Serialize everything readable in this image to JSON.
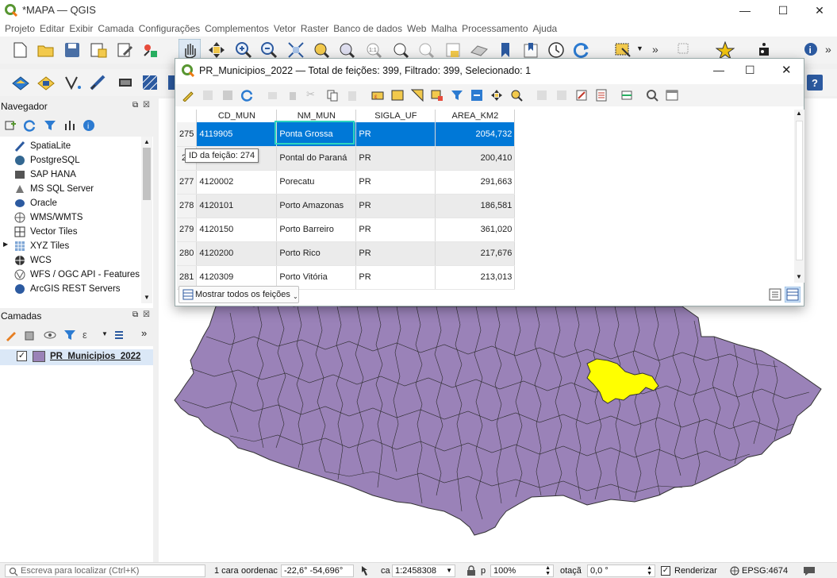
{
  "app": {
    "title": "*MAPA — QGIS"
  },
  "menu": [
    "Projeto",
    "Editar",
    "Exibir",
    "Camada",
    "Configurações",
    "Complementos",
    "Vetor",
    "Raster",
    "Banco de dados",
    "Web",
    "Malha",
    "Processamento",
    "Ajuda"
  ],
  "navigator": {
    "title": "Navegador",
    "items": [
      "SpatiaLite",
      "PostgreSQL",
      "SAP HANA",
      "MS SQL Server",
      "Oracle",
      "WMS/WMTS",
      "Vector Tiles",
      "XYZ Tiles",
      "WCS",
      "WFS / OGC API - Features",
      "ArcGIS REST Servers"
    ]
  },
  "layers": {
    "title": "Camadas",
    "layer_name": "PR_Municipios_2022"
  },
  "dialog": {
    "title": "PR_Municipios_2022 — Total de feições: 399, Filtrado: 399, Selecionado: 1",
    "columns": [
      "CD_MUN",
      "NM_MUN",
      "SIGLA_UF",
      "AREA_KM2"
    ],
    "rows": [
      {
        "n": "275",
        "cd": "4119905",
        "nm": "Ponta Grossa",
        "uf": "PR",
        "area": "2054,732"
      },
      {
        "n": "27",
        "cd": "",
        "nm": "Pontal do Paraná",
        "uf": "PR",
        "area": "200,410"
      },
      {
        "n": "277",
        "cd": "4120002",
        "nm": "Porecatu",
        "uf": "PR",
        "area": "291,663"
      },
      {
        "n": "278",
        "cd": "4120101",
        "nm": "Porto Amazonas",
        "uf": "PR",
        "area": "186,581"
      },
      {
        "n": "279",
        "cd": "4120150",
        "nm": "Porto Barreiro",
        "uf": "PR",
        "area": "361,020"
      },
      {
        "n": "280",
        "cd": "4120200",
        "nm": "Porto Rico",
        "uf": "PR",
        "area": "217,676"
      },
      {
        "n": "281",
        "cd": "4120309",
        "nm": "Porto Vitória",
        "uf": "PR",
        "area": "213,013"
      }
    ],
    "tooltip": "ID da feição: 274",
    "show_all": "Mostrar todos os feições"
  },
  "status": {
    "locator_placeholder": "Escreva para localizar (Ctrl+K)",
    "coord_label": "1 cara",
    "coord_label2": "oordenac",
    "coordinate": "-22,6°  -54,696°",
    "scale_label": "ca",
    "scale": "1:2458308",
    "mag_label": "p",
    "magnifier": "100%",
    "rot_label": "otaçã",
    "rotation": "0,0 °",
    "render": "Renderizar",
    "crs": "EPSG:4674"
  },
  "colors": {
    "layer_fill": "#9a82b8",
    "selected": "#ffff00",
    "selection_blue": "#0078d7",
    "qgis_green": "#589632"
  }
}
